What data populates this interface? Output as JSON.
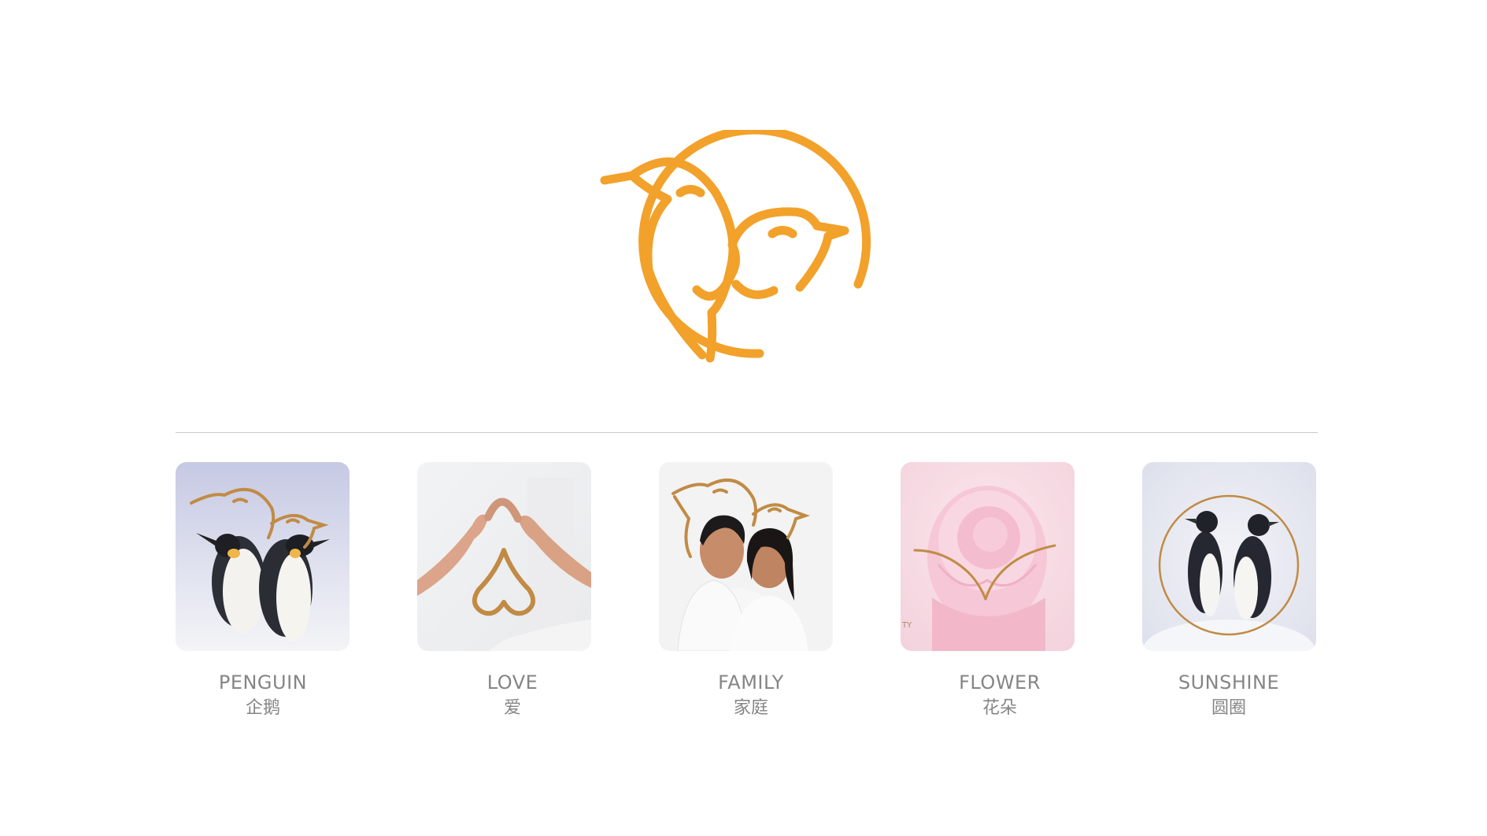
{
  "brand": {
    "logo_icon": "penguin-couple-heart-logo",
    "accent_color": "#F2A12A",
    "image_line_color": "#C18B45"
  },
  "concepts": [
    {
      "label_en": "PENGUIN",
      "label_cn": "企鹅",
      "image": "emperor-penguins-photo"
    },
    {
      "label_en": "LOVE",
      "label_cn": "爱",
      "image": "hands-heart-photo"
    },
    {
      "label_en": "FAMILY",
      "label_cn": "家庭",
      "image": "couple-photo"
    },
    {
      "label_en": "FLOWER",
      "label_cn": "花朵",
      "image": "pink-rose-photo"
    },
    {
      "label_en": "SUNSHINE",
      "label_cn": "圆圈",
      "image": "penguins-in-circle-photo"
    }
  ]
}
